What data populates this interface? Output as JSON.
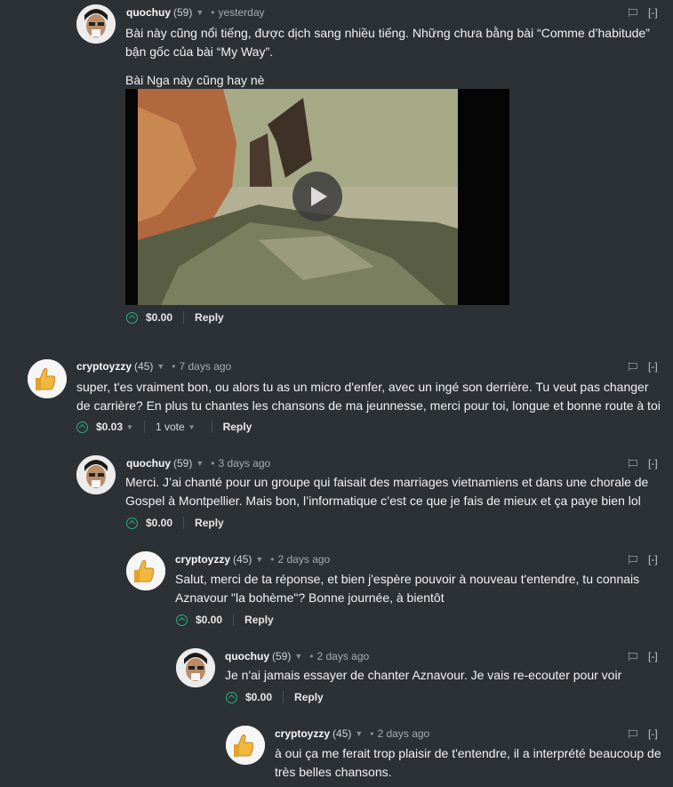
{
  "colors": {
    "background": "#2c3136",
    "upvote": "#2ab27b",
    "text": "#f2f2f2",
    "muted": "#a6acb1"
  },
  "flag_icon": "flag-icon",
  "collapse_label": "[-]",
  "reply_label": "Reply",
  "comments": [
    {
      "author": "quochuy",
      "rep": "(59)",
      "time": "yesterday",
      "paragraphs": [
        "Bài này cũng nổi tiếng, được dịch sang nhiều tiếng. Những chưa bằng bài “Comme d’habitude” bận gốc của bài “My Way”.",
        "Bài Nga này cũng hay nè"
      ],
      "payout": "$0.00",
      "votes": ""
    },
    {
      "author": "cryptoyzzy",
      "rep": "(45)",
      "time": "7 days ago",
      "paragraphs": [
        "super, t'es vraiment bon, ou alors tu as un micro d'enfer, avec un ingé son derrière. Tu veut pas changer de carrière? En plus tu chantes les chansons de ma jeunnesse, merci pour toi, longue et bonne route à toi"
      ],
      "payout": "$0.03",
      "votes": "1 vote"
    },
    {
      "author": "quochuy",
      "rep": "(59)",
      "time": "3 days ago",
      "paragraphs": [
        "Merci. J’ai chanté pour un groupe qui faisait des marriages vietnamiens et dans une chorale de Gospel à Montpellier. Mais bon, l’informatique c’est ce que je fais de mieux et ça paye bien lol"
      ],
      "payout": "$0.00",
      "votes": ""
    },
    {
      "author": "cryptoyzzy",
      "rep": "(45)",
      "time": "2 days ago",
      "paragraphs": [
        "Salut, merci de ta réponse, et bien j'espère pouvoir à nouveau t'entendre, tu connais Aznavour \"la bohème\"? Bonne journée, à bientôt"
      ],
      "payout": "$0.00",
      "votes": ""
    },
    {
      "author": "quochuy",
      "rep": "(59)",
      "time": "2 days ago",
      "paragraphs": [
        "Je n'ai jamais essayer de chanter Aznavour. Je vais re-ecouter pour voir"
      ],
      "payout": "$0.00",
      "votes": ""
    },
    {
      "author": "cryptoyzzy",
      "rep": "(45)",
      "time": "2 days ago",
      "paragraphs": [
        "à oui ça me ferait trop plaisir de t'entendre, il a interprété beaucoup de très belles chansons."
      ],
      "payout": "",
      "votes": ""
    }
  ]
}
